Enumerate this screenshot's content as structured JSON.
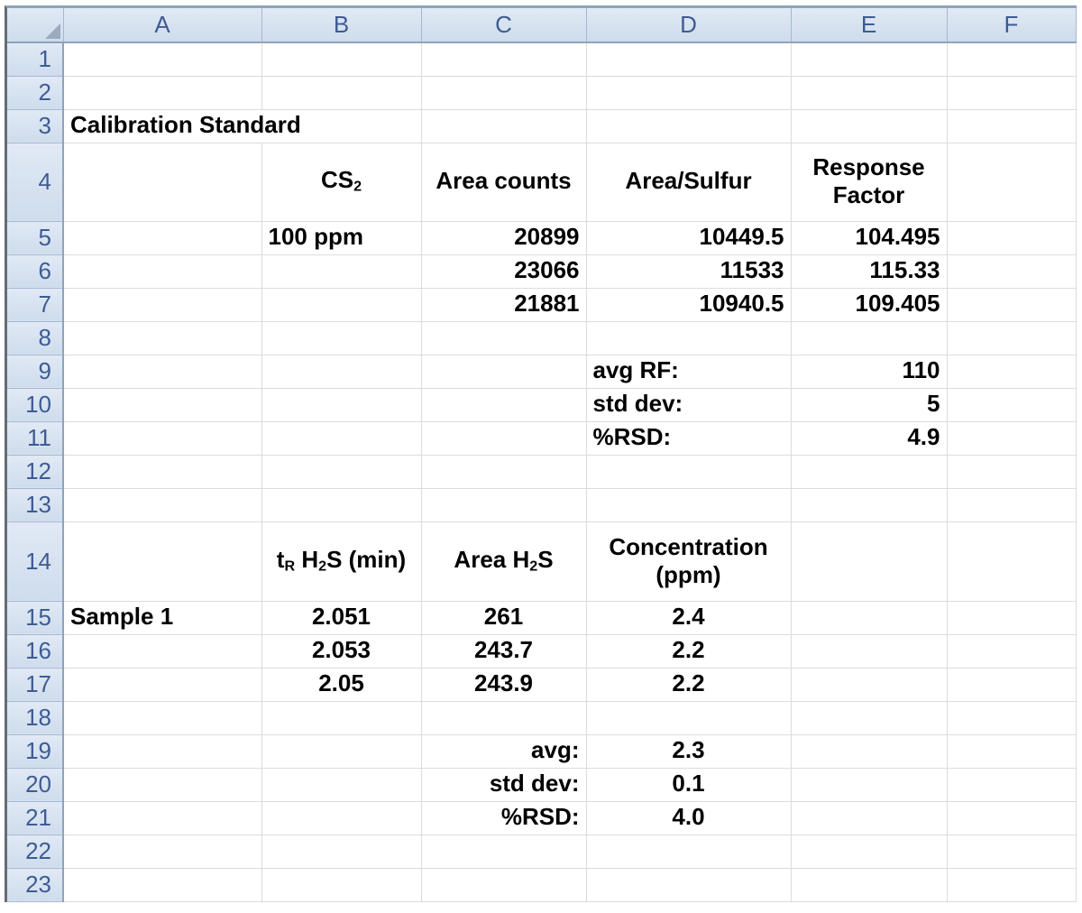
{
  "app": {
    "kind": "excel-worksheet"
  },
  "colors": {
    "header_bg_top": "#E1E9F5",
    "header_bg_bottom": "#CEDCEC",
    "header_border": "#A5B8D2",
    "header_edge": "#8FA3B9",
    "header_text": "#3E5C93",
    "gridline": "#DCDCDC",
    "cell_text": "#000000",
    "sheet_edge_left": "#666C75",
    "triangle": "#9BAABE"
  },
  "grid": {
    "columns": [
      "A",
      "B",
      "C",
      "D",
      "E",
      "F"
    ],
    "row_count": 23,
    "cells": {
      "A3": {
        "text": "Calibration Standard",
        "align": "left",
        "colspan": 2
      },
      "B4": {
        "runs": [
          {
            "t": "CS"
          },
          {
            "t": "2",
            "sub": true
          }
        ],
        "align": "center",
        "valign": "middle"
      },
      "C4": {
        "text": "Area counts",
        "align": "center",
        "valign": "middle"
      },
      "D4": {
        "text": "Area/Sulfur",
        "align": "center",
        "valign": "middle"
      },
      "E4": {
        "text": "Response Factor",
        "align": "center",
        "valign": "middle",
        "wrap": true
      },
      "B5": {
        "text": "100 ppm",
        "align": "left"
      },
      "C5": {
        "text": "20899",
        "align": "right"
      },
      "D5": {
        "text": "10449.5",
        "align": "right"
      },
      "E5": {
        "text": "104.495",
        "align": "right"
      },
      "C6": {
        "text": "23066",
        "align": "right"
      },
      "D6": {
        "text": "11533",
        "align": "right"
      },
      "E6": {
        "text": "115.33",
        "align": "right"
      },
      "C7": {
        "text": "21881",
        "align": "right"
      },
      "D7": {
        "text": "10940.5",
        "align": "right"
      },
      "E7": {
        "text": "109.405",
        "align": "right"
      },
      "D9": {
        "text": "avg RF:",
        "align": "left"
      },
      "E9": {
        "text": "110",
        "align": "right"
      },
      "D10": {
        "text": "std dev:",
        "align": "left"
      },
      "E10": {
        "text": "5",
        "align": "right"
      },
      "D11": {
        "text": "%RSD:",
        "align": "left"
      },
      "E11": {
        "text": "4.9",
        "align": "right"
      },
      "B14": {
        "runs": [
          {
            "t": "t"
          },
          {
            "t": "R",
            "sub": true
          },
          {
            "t": " H"
          },
          {
            "t": "2",
            "sub": true
          },
          {
            "t": "S (min)"
          }
        ],
        "align": "center",
        "valign": "middle"
      },
      "C14": {
        "runs": [
          {
            "t": "Area H"
          },
          {
            "t": "2",
            "sub": true
          },
          {
            "t": "S"
          }
        ],
        "align": "center",
        "valign": "middle"
      },
      "D14": {
        "text": "Concentration (ppm)",
        "align": "center",
        "valign": "middle",
        "wrap": true
      },
      "A15": {
        "text": "Sample 1",
        "align": "left"
      },
      "B15": {
        "text": "2.051",
        "align": "center"
      },
      "C15": {
        "text": "261",
        "align": "center"
      },
      "D15": {
        "text": "2.4",
        "align": "center"
      },
      "B16": {
        "text": "2.053",
        "align": "center"
      },
      "C16": {
        "text": "243.7",
        "align": "center"
      },
      "D16": {
        "text": "2.2",
        "align": "center"
      },
      "B17": {
        "text": "2.05",
        "align": "center"
      },
      "C17": {
        "text": "243.9",
        "align": "center"
      },
      "D17": {
        "text": "2.2",
        "align": "center"
      },
      "C19": {
        "text": "avg:",
        "align": "right"
      },
      "D19": {
        "text": "2.3",
        "align": "center"
      },
      "C20": {
        "text": "std dev:",
        "align": "right"
      },
      "D20": {
        "text": "0.1",
        "align": "center"
      },
      "C21": {
        "text": "%RSD:",
        "align": "right"
      },
      "D21": {
        "text": "4.0",
        "align": "center"
      }
    }
  }
}
